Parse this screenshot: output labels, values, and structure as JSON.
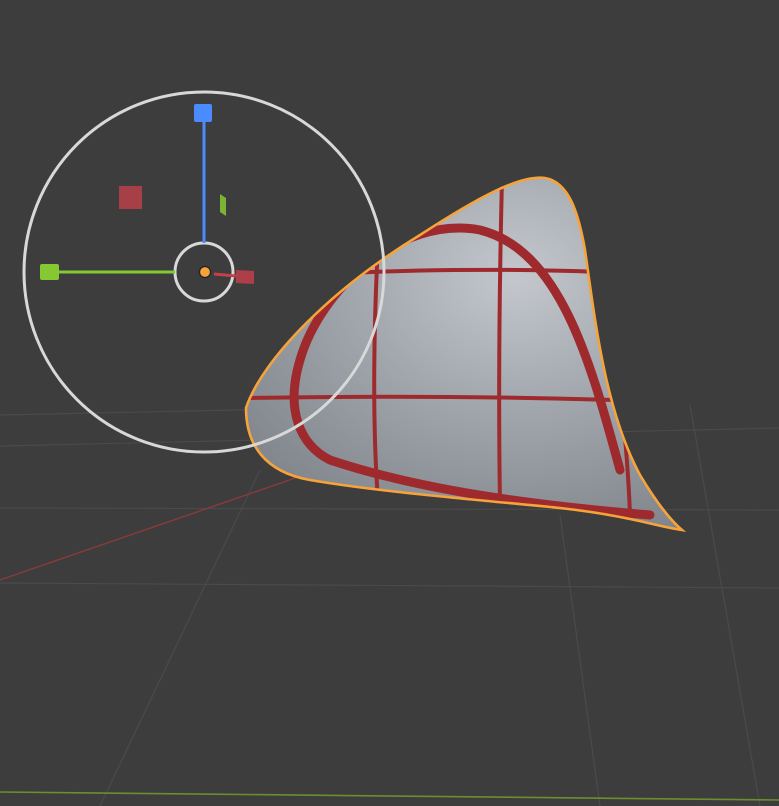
{
  "viewport": {
    "background": "#3d3d3d",
    "grid_color": "#4a4a4a",
    "x_axis_color": "#8a3a3a",
    "y_axis_color": "#6b8f2f"
  },
  "selected_object": {
    "outline_color": "#f5a33a",
    "surface_color": "#9aa0a8",
    "pattern_color": "#9e2a2e"
  },
  "gizmo": {
    "ring_color": "#d8d8d8",
    "z_handle_color": "#4a8cff",
    "y_handle_color": "#86c832",
    "x_handle_color": "#c2404a",
    "origin_color": "#f5a33a",
    "icons": [
      "move-gizmo-icon",
      "z-axis-handle-icon",
      "y-axis-handle-icon",
      "x-axis-handle-icon",
      "origin-dot-icon"
    ]
  }
}
